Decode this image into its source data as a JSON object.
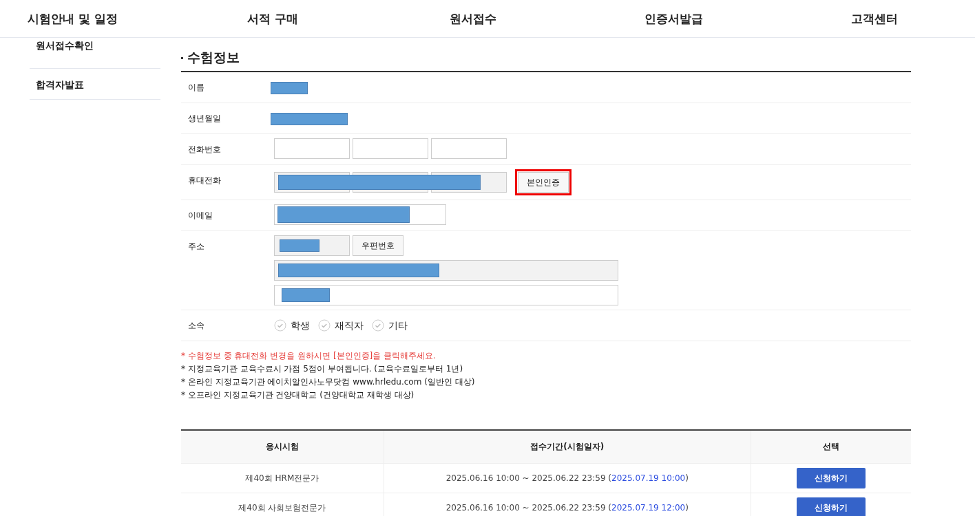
{
  "nav": [
    "시험안내 및 일정",
    "서적 구매",
    "원서접수",
    "인증서발급",
    "고객센터"
  ],
  "sidebar": {
    "items": [
      "원서접수확인",
      "합격자발표"
    ]
  },
  "section_title": "수험정보",
  "form": [
    {
      "kind": "redacted",
      "label": "이름"
    },
    {
      "kind": "redacted-long",
      "label": "생년월일"
    },
    {
      "kind": "phone",
      "label": "전화번호"
    },
    {
      "kind": "mobile",
      "label": "휴대전화",
      "button": "본인인증",
      "highlighted": true
    },
    {
      "kind": "email",
      "label": "이메일"
    },
    {
      "kind": "address",
      "label": "주소",
      "button": "우편번호"
    },
    {
      "kind": "radio",
      "label": "소속",
      "options": [
        {
          "label": "학생",
          "selected": false
        },
        {
          "label": "재직자",
          "selected": false
        },
        {
          "label": "기타",
          "selected": false
        }
      ]
    }
  ],
  "notes": [
    {
      "kind": "warning",
      "text": "* 수험정보 중 휴대전화 변경을 원하시면 [본인인증]을 클릭해주세요."
    },
    {
      "kind": "normal",
      "text": "* 지정교육기관 교육수료시 가점 5점이 부여됩니다. (교육수료일로부터 1년)"
    },
    {
      "kind": "normal",
      "text": "* 온라인 지정교육기관 에이치알인사노무닷컴 www.hrledu.com (일반인 대상)"
    },
    {
      "kind": "normal",
      "text": "* 오프라인 지정교육기관 건양대학교 (건양대학교 재학생 대상)"
    }
  ],
  "table": {
    "columns": [
      "응시시험",
      "접수기간(시험일자)",
      "선택"
    ],
    "rows": [
      {
        "exam": "제40회 HRM전문가",
        "period": "2025.06.16 10:00 ~ 2025.06.22 23:59 (",
        "date": "2025.07.19 10:00",
        "close": ")",
        "action": "신청하기"
      },
      {
        "exam": "제40회 사회보험전문가",
        "period": "2025.06.16 10:00 ~ 2025.06.22 23:59 (",
        "date": "2025.07.19 12:00",
        "close": ")",
        "action": "신청하기"
      }
    ]
  }
}
